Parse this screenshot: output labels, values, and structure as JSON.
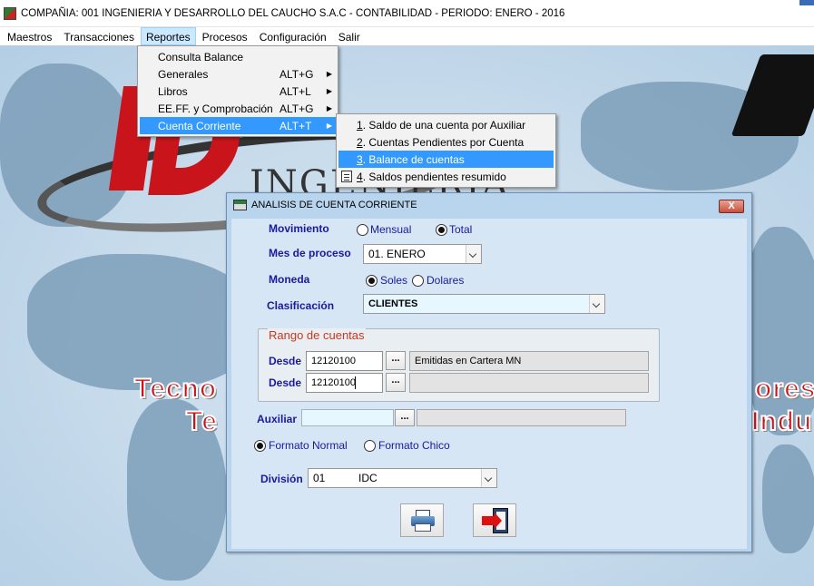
{
  "window": {
    "title": "COMPAÑIA:  001 INGENIERIA Y DESARROLLO DEL CAUCHO S.A.C   -   CONTABILIDAD   -   PERIODO: ENERO - 2016"
  },
  "menubar": {
    "items": [
      {
        "label": "Maestros"
      },
      {
        "label": "Transacciones"
      },
      {
        "label": "Reportes"
      },
      {
        "label": "Procesos"
      },
      {
        "label": "Configuración"
      },
      {
        "label": "Salir"
      }
    ]
  },
  "reportes_menu": {
    "items": [
      {
        "label": "Consulta Balance",
        "shortcut": ""
      },
      {
        "label": "Generales",
        "shortcut": "ALT+G"
      },
      {
        "label": "Libros",
        "shortcut": "ALT+L"
      },
      {
        "label": "EE.FF. y Comprobación",
        "shortcut": "ALT+G"
      },
      {
        "label": "Cuenta Corriente",
        "shortcut": "ALT+T"
      }
    ]
  },
  "cuenta_corriente_menu": {
    "items": [
      {
        "num": "1",
        "label": ". Saldo de una cuenta por Auxiliar"
      },
      {
        "num": "2",
        "label": ". Cuentas Pendientes por Cuenta"
      },
      {
        "num": "3",
        "label": ". Balance de cuentas"
      },
      {
        "num": "4",
        "label": ". Saldos pendientes resumido"
      }
    ]
  },
  "background": {
    "brand_word": "INGENIERIA",
    "slogan_left_1": "Tecno",
    "slogan_left_2": "Te",
    "slogan_right_1": "ores",
    "slogan_right_2": "Indu"
  },
  "dialog": {
    "title": "ANALISIS DE CUENTA CORRIENTE",
    "close_label": "X",
    "movimiento": {
      "label": "Movimiento",
      "opt1": "Mensual",
      "opt2": "Total",
      "selected": "Total"
    },
    "mes": {
      "label": "Mes de proceso",
      "value": "01. ENERO"
    },
    "moneda": {
      "label": "Moneda",
      "opt1": "Soles",
      "opt2": "Dolares",
      "selected": "Soles"
    },
    "clasificacion": {
      "label": "Clasificación",
      "value": "CLIENTES"
    },
    "rango": {
      "title": "Rango de cuentas",
      "row1": {
        "label": "Desde",
        "value": "12120100",
        "button": "...",
        "desc": "Emitidas en Cartera MN"
      },
      "row2": {
        "label": "Desde",
        "value": "12120100",
        "button": "...",
        "desc": ""
      }
    },
    "auxiliar": {
      "label": "Auxiliar",
      "value": "",
      "button": "...",
      "desc": ""
    },
    "formato": {
      "opt1": "Formato Normal",
      "opt2": "Formato Chico",
      "selected": "Formato Normal"
    },
    "division": {
      "label": "División",
      "code": "01",
      "name": "IDC"
    }
  },
  "colors": {
    "label_blue": "#1a1a9c",
    "highlight": "#3399ff",
    "group_title": "#c7381f",
    "dialog_frame": "#b9d5ee",
    "brand_red": "#c9141c"
  }
}
